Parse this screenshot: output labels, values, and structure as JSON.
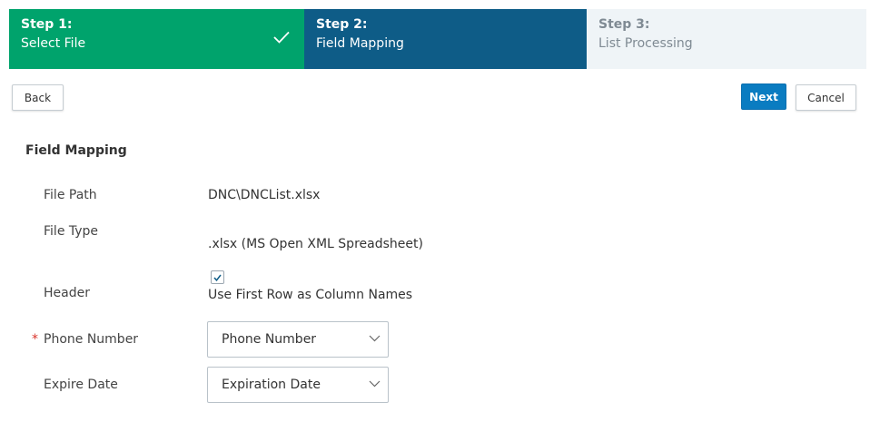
{
  "wizard": {
    "steps": [
      {
        "number": "Step 1:",
        "title": "Select File",
        "state": "completed"
      },
      {
        "number": "Step 2:",
        "title": "Field Mapping",
        "state": "active"
      },
      {
        "number": "Step 3:",
        "title": "List Processing",
        "state": "pending"
      }
    ]
  },
  "toolbar": {
    "back_label": "Back",
    "next_label": "Next",
    "cancel_label": "Cancel"
  },
  "section": {
    "title": "Field Mapping",
    "fields": {
      "file_path": {
        "label": "File Path",
        "value": "DNC\\DNCList.xlsx"
      },
      "file_type": {
        "label": "File Type",
        "value": ".xlsx (MS Open XML Spreadsheet)"
      },
      "header": {
        "label": "Header",
        "checkbox_label": "Use First Row as Column Names",
        "checked": true
      },
      "phone_number": {
        "label": "Phone Number",
        "required_mark": "*",
        "selected": "Phone Number"
      },
      "expire_date": {
        "label": "Expire Date",
        "selected": "Expiration Date"
      }
    }
  },
  "colors": {
    "completed_step": "#00a36c",
    "active_step": "#0e5c87",
    "pending_step": "#eff4f7",
    "primary_button": "#0a7cc1",
    "required": "#d9342b"
  }
}
